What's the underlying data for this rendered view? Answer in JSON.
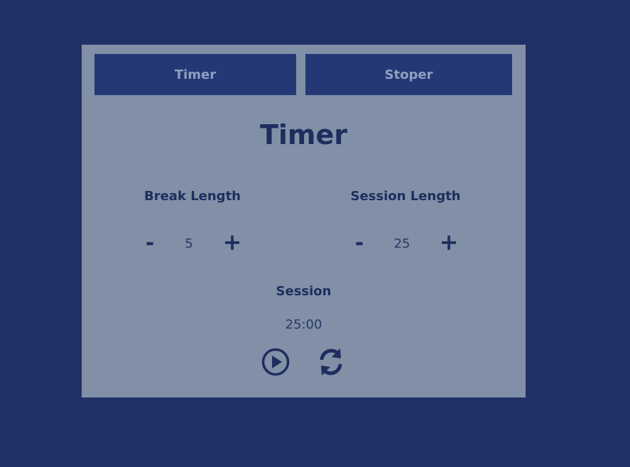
{
  "tabs": [
    {
      "label": "Timer"
    },
    {
      "label": "Stoper"
    }
  ],
  "title": "Timer",
  "break": {
    "label": "Break Length",
    "decrement": "-",
    "value": "5",
    "increment": "+"
  },
  "session": {
    "label": "Session Length",
    "decrement": "-",
    "value": "25",
    "increment": "+"
  },
  "display": {
    "mode": "Session",
    "time": "25:00"
  },
  "icons": {
    "play": "play-circle-icon",
    "reset": "refresh-icon"
  },
  "colors": {
    "background": "#213066",
    "panel": "#8190a6",
    "tab": "#253876",
    "tab_text": "#8ea0bf",
    "text_dark": "#1f2d5e"
  }
}
